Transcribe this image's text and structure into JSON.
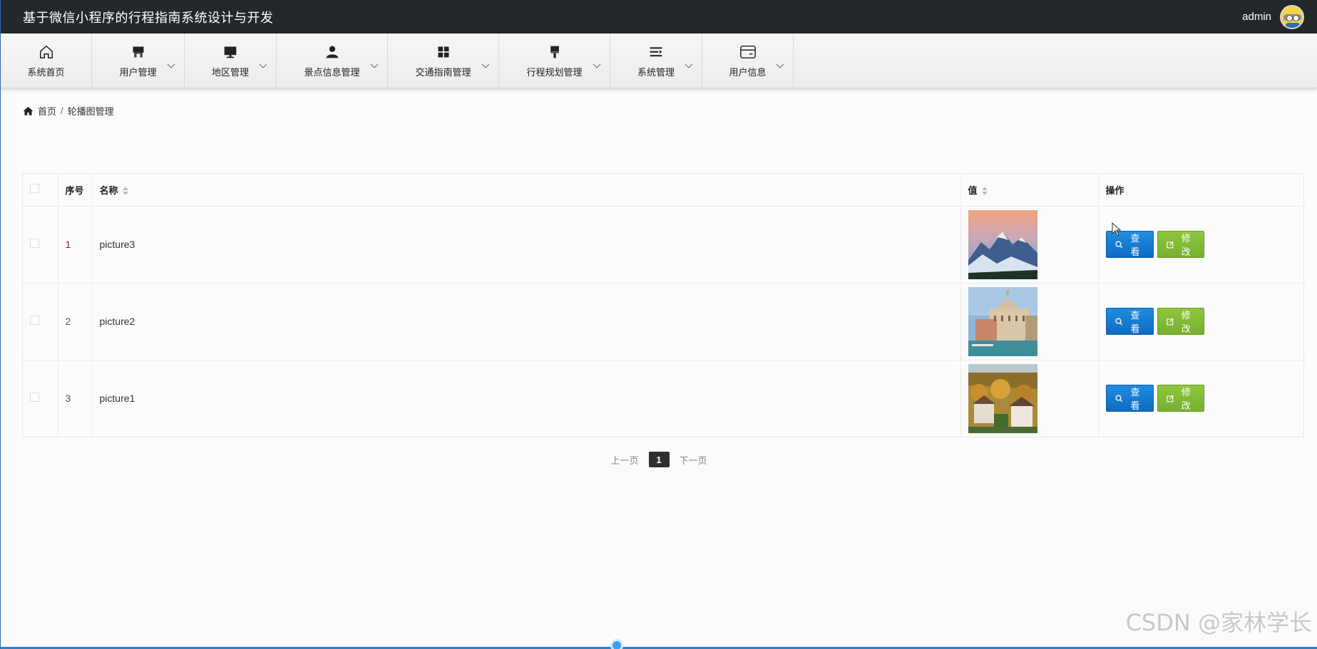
{
  "header": {
    "title": "基于微信小程序的行程指南系统设计与开发",
    "username": "admin"
  },
  "nav": {
    "items": [
      {
        "label": "系统首页",
        "icon": "home-icon",
        "has_dropdown": false
      },
      {
        "label": "用户管理",
        "icon": "store-icon",
        "has_dropdown": true
      },
      {
        "label": "地区管理",
        "icon": "monitor-icon",
        "has_dropdown": true
      },
      {
        "label": "景点信息管理",
        "icon": "user-icon",
        "has_dropdown": true
      },
      {
        "label": "交通指南管理",
        "icon": "grid-icon",
        "has_dropdown": true
      },
      {
        "label": "行程规划管理",
        "icon": "brush-icon",
        "has_dropdown": true
      },
      {
        "label": "系统管理",
        "icon": "list-indent-icon",
        "has_dropdown": true
      },
      {
        "label": "用户信息",
        "icon": "card-icon",
        "has_dropdown": true
      }
    ]
  },
  "breadcrumb": {
    "home": "首页",
    "separator": "/",
    "current": "轮播图管理"
  },
  "table": {
    "columns": {
      "index": "序号",
      "name": "名称",
      "value": "值",
      "actions": "操作"
    },
    "rows": [
      {
        "index": "1",
        "name": "picture3",
        "image": "mountain-sunset"
      },
      {
        "index": "2",
        "name": "picture2",
        "image": "venice-church"
      },
      {
        "index": "3",
        "name": "picture1",
        "image": "autumn-village"
      }
    ],
    "view_label": "查看",
    "edit_label": "修改"
  },
  "pagination": {
    "prev": "上一页",
    "current": "1",
    "next": "下一页"
  },
  "watermark": "CSDN @家林学长",
  "colors": {
    "topbar": "#25282b",
    "view_button": "#1479cf",
    "edit_button": "#82bb37"
  }
}
